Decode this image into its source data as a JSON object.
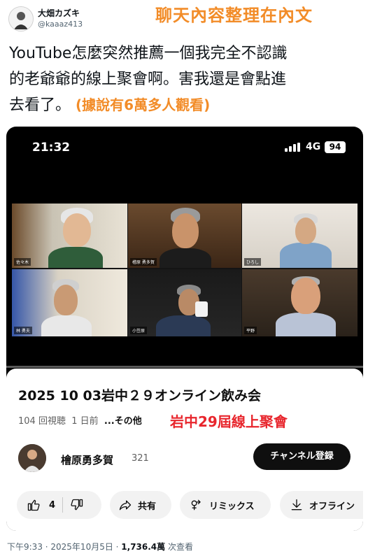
{
  "tweet": {
    "author_name": "大畑カズキ",
    "author_handle": "@kaaaz413",
    "overlay_title": "聊天內容整理在內文",
    "text_line1": "YouTube怎麼突然推薦一個我完全不認識",
    "text_line2": "的老爺爺的線上聚會啊。害我還是會點進",
    "text_line3": "去看了。",
    "text_note": "(據說有6萬多人觀看)",
    "footer_time": "下午9:33 · 2025年10月5日 · ",
    "footer_views": "1,736.4萬",
    "footer_views_suffix": " 次查看"
  },
  "phone": {
    "status_time": "21:32",
    "network": "4G",
    "battery": "94",
    "video_progress": 0.0,
    "participants": [
      {
        "tag": "佐々木"
      },
      {
        "tag": "檜原 勇多賀"
      },
      {
        "tag": "ひろし"
      },
      {
        "tag": "林 勇夫"
      },
      {
        "tag": "小笠原"
      },
      {
        "tag": "平野"
      }
    ]
  },
  "video": {
    "title": "2025 10 03岩中２９オンライン飲み会",
    "views": "104 回視聴",
    "age": "1 日前",
    "more": "...その他",
    "overlay_sub": "岩中29屆線上聚會",
    "channel_name": "檜原勇多賀",
    "channel_subs": "321",
    "subscribe_label": "チャンネル登録",
    "like_count": "4",
    "share_label": "共有",
    "remix_label": "リミックス",
    "offline_label": "オフライン"
  },
  "colors": {
    "accent_orange": "#f28c28",
    "accent_red": "#e8262d",
    "progress_red": "#ff0000"
  }
}
